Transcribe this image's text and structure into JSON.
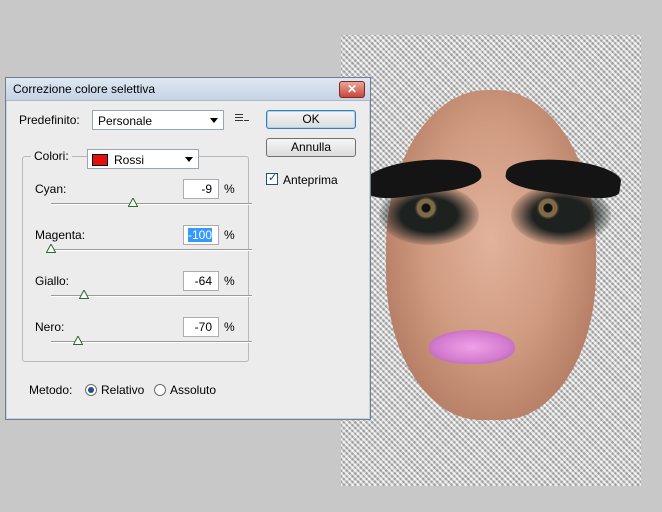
{
  "dialog": {
    "title": "Correzione colore selettiva",
    "preset": {
      "label": "Predefinito:",
      "value": "Personale",
      "menu_icon": "preset-options-icon"
    },
    "buttons": {
      "ok": "OK",
      "cancel": "Annulla"
    },
    "preview": {
      "label": "Anteprima",
      "checked": true
    },
    "colors": {
      "label": "Colori:",
      "value": "Rossi",
      "swatch": "#e30e0e"
    },
    "sliders": [
      {
        "label": "Cyan:",
        "value": "-9",
        "unit": "%",
        "amount": -9
      },
      {
        "label": "Magenta:",
        "value": "-100",
        "unit": "%",
        "amount": -100
      },
      {
        "label": "Giallo:",
        "value": "-64",
        "unit": "%",
        "amount": -64
      },
      {
        "label": "Nero:",
        "value": "-70",
        "unit": "%",
        "amount": -70
      }
    ],
    "method": {
      "label": "Metodo:",
      "options": [
        "Relativo",
        "Assoluto"
      ],
      "selected": "Relativo"
    }
  }
}
